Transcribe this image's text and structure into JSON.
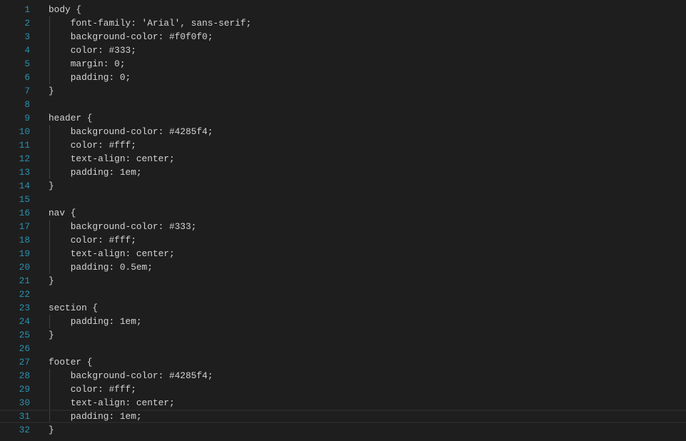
{
  "editor": {
    "language": "css",
    "active_line": 31,
    "lines": [
      "body {",
      "    font-family: 'Arial', sans-serif;",
      "    background-color: #f0f0f0;",
      "    color: #333;",
      "    margin: 0;",
      "    padding: 0;",
      "}",
      "",
      "header {",
      "    background-color: #4285f4;",
      "    color: #fff;",
      "    text-align: center;",
      "    padding: 1em;",
      "}",
      "",
      "nav {",
      "    background-color: #333;",
      "    color: #fff;",
      "    text-align: center;",
      "    padding: 0.5em;",
      "}",
      "",
      "section {",
      "    padding: 1em;",
      "}",
      "",
      "footer {",
      "    background-color: #4285f4;",
      "    color: #fff;",
      "    text-align: center;",
      "    padding: 1em;",
      "}"
    ]
  },
  "colors": {
    "background": "#1e1e1e",
    "text": "#d4d4d4",
    "line_number": "#2b91af"
  }
}
